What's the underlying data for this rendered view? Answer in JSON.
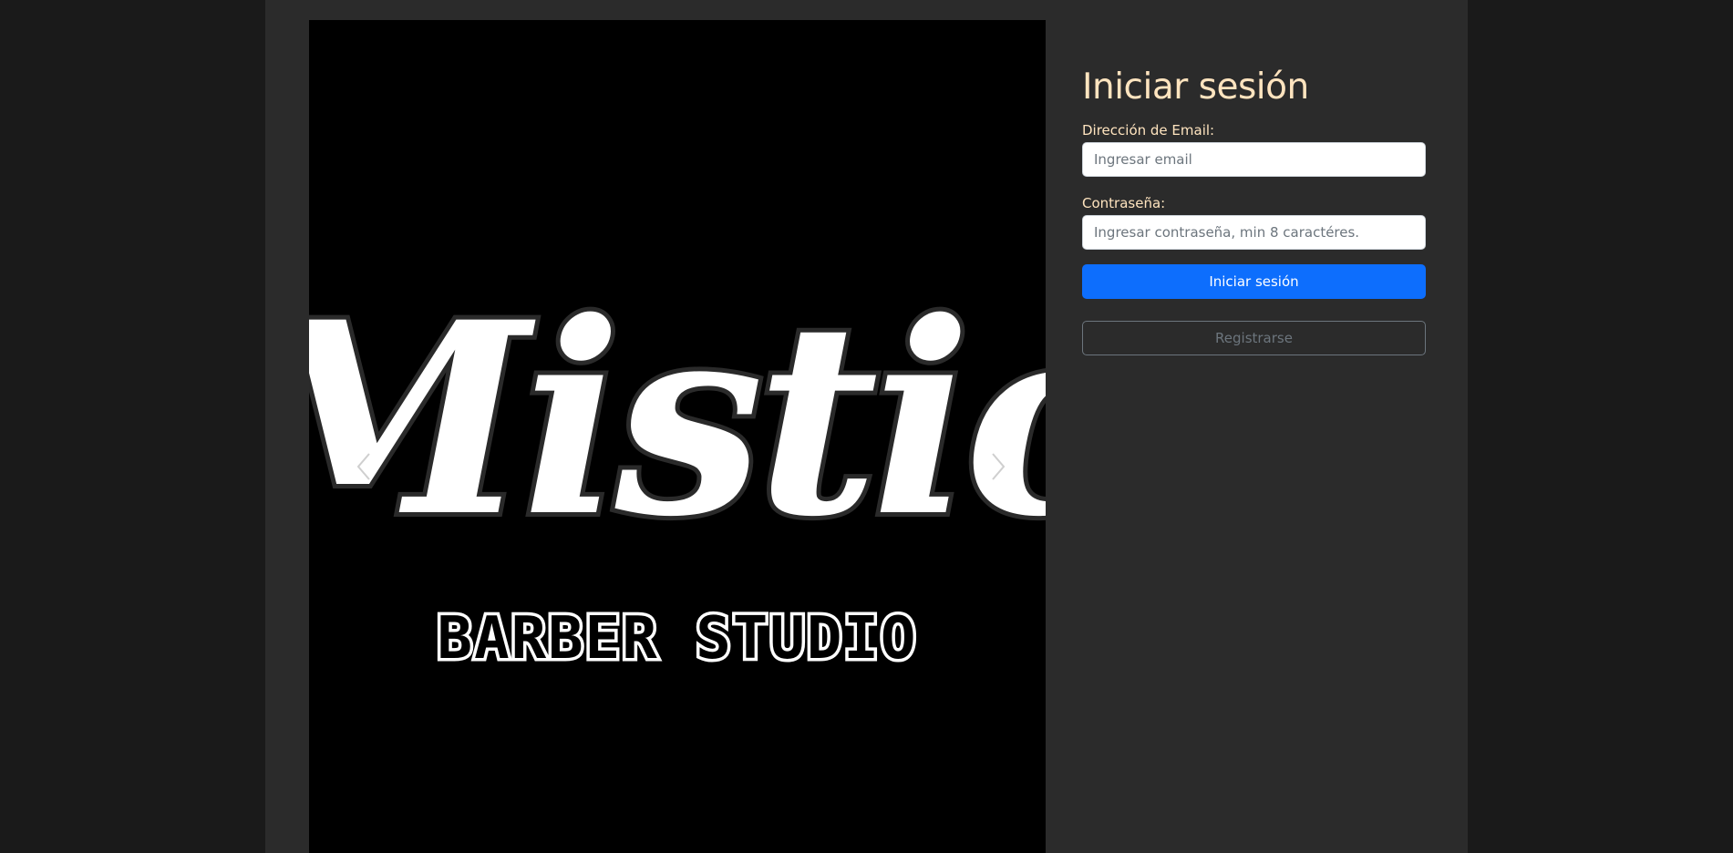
{
  "login": {
    "title": "Iniciar sesión",
    "email_label": "Dirección de Email:",
    "email_placeholder": "Ingresar email",
    "email_value": "",
    "password_label": "Contraseña:",
    "password_placeholder": "Ingresar contraseña, min 8 caractéres.",
    "password_value": "",
    "submit_label": "Iniciar sesión",
    "register_label": "Registrarse"
  },
  "carousel": {
    "logo_text": "Mistic",
    "logo_subtitle": "BARBER STUDIO",
    "prev_icon": "chevron-left-icon",
    "next_icon": "chevron-right-icon"
  },
  "colors": {
    "page_bg": "#1a1a1a",
    "container_bg": "#2b2b2b",
    "heading": "#ffe4bf",
    "primary": "#0d6efd",
    "secondary": "#6c757d"
  }
}
